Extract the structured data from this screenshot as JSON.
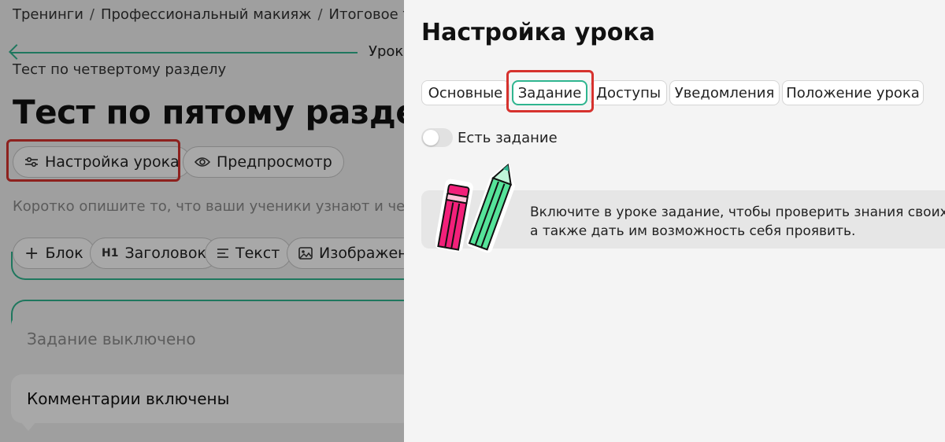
{
  "breadcrumb": {
    "items": [
      "Тренинги",
      "Профессиональный макияж",
      "Итоговое те"
    ],
    "separator": "/"
  },
  "lesson_nav": {
    "next_label": "Урок",
    "prev_label": "Тест по четвертому разделу"
  },
  "lesson": {
    "title": "Тест по пятому разделу",
    "settings_button": "Настройка урока",
    "preview_button": "Предпросмотр",
    "description_placeholder": "Коротко опишите то, что ваши ученики узнают и чему н"
  },
  "toolbar": {
    "block": "Блок",
    "heading": "Заголовок",
    "heading_icon": "H1",
    "text": "Текст",
    "image": "Изображени"
  },
  "status_cards": {
    "task": "Задание выключено",
    "comments": "Комментарии включены"
  },
  "panel": {
    "title": "Настройка урока",
    "tabs": [
      "Основные",
      "Задание",
      "Доступы",
      "Уведомления",
      "Положение урока"
    ],
    "active_tab": "Задание",
    "toggle": {
      "label": "Есть задание",
      "checked": false
    },
    "info": {
      "line1": "Включите в уроке задание, чтобы проверить знания своих",
      "line2": "а также дать им возможность себя проявить."
    }
  },
  "colors": {
    "accent_green": "#2fb58f",
    "highlight_red": "#d6322e",
    "pencil_pink": "#f2207a",
    "pencil_green": "#56e39a"
  },
  "icons": {
    "back": "arrow-left-icon",
    "settings": "sliders-icon",
    "preview": "eye-icon",
    "block": "plus-icon",
    "text": "lines-icon",
    "image": "image-icon",
    "illustration": "pencils-illustration"
  }
}
